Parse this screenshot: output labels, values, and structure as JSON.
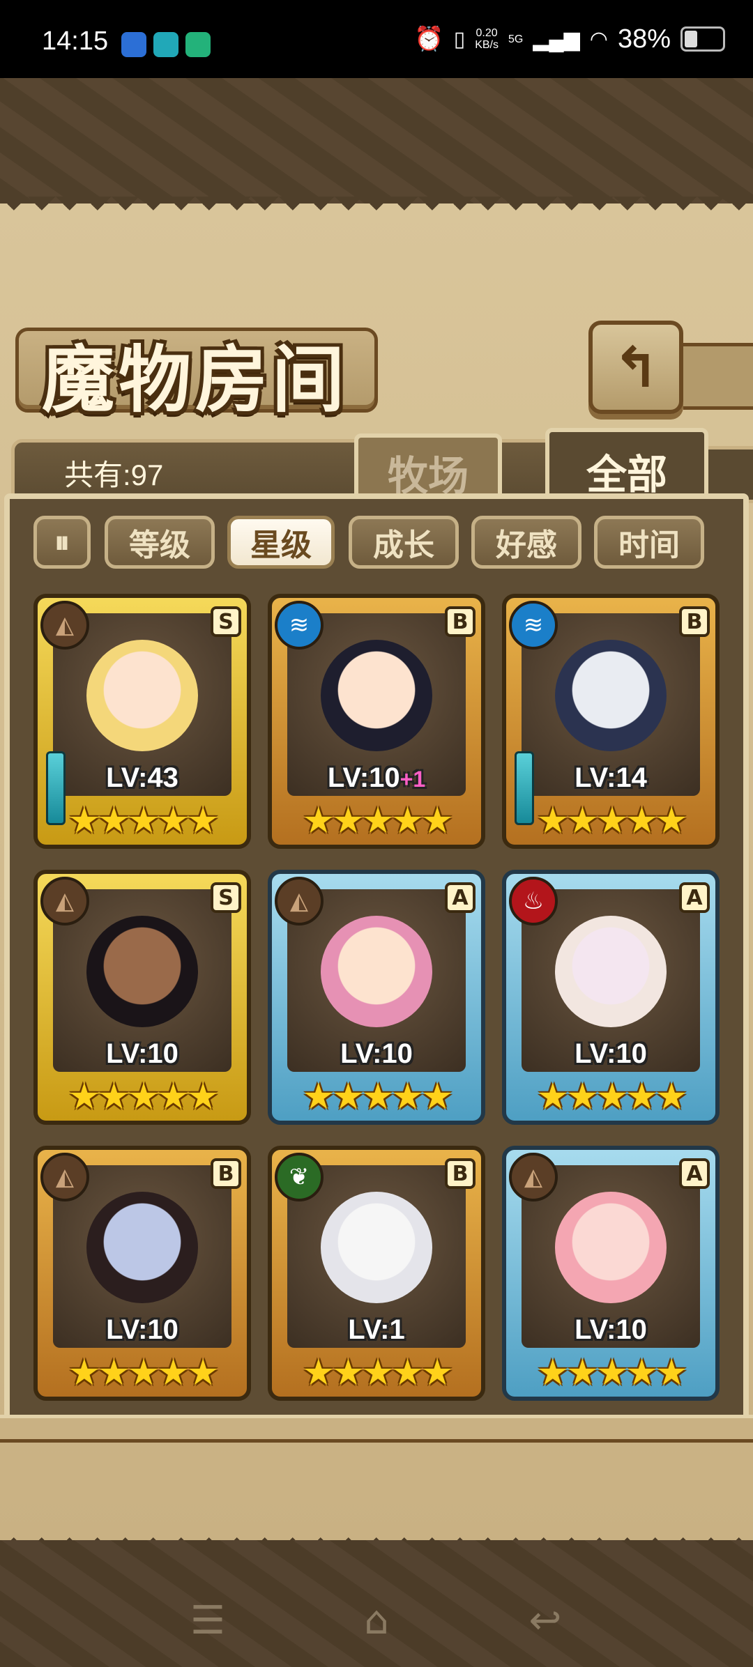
{
  "status_bar": {
    "time": "14:15",
    "net_speed_value": "0.20",
    "net_speed_unit": "KB/s",
    "network": "5G",
    "battery": "38%"
  },
  "header": {
    "title": "魔物房间",
    "back_icon": "back-arrow-icon"
  },
  "summary": {
    "count_label": "共有:97"
  },
  "tabs": [
    {
      "label": "牧场",
      "active": false
    },
    {
      "label": "全部",
      "active": true
    }
  ],
  "sort": {
    "toggle_icon": "sort-direction-icon",
    "options": [
      {
        "label": "等级",
        "active": false
      },
      {
        "label": "星级",
        "active": true
      },
      {
        "label": "成长",
        "active": false
      },
      {
        "label": "好感",
        "active": false
      },
      {
        "label": "时间",
        "active": false
      }
    ]
  },
  "monsters": [
    {
      "level": "LV:43",
      "plus": "",
      "rank": "S",
      "element": "earth",
      "frame": "gold",
      "stars": "★★★★★",
      "weapon": true
    },
    {
      "level": "LV:10",
      "plus": "+1",
      "rank": "B",
      "element": "water",
      "frame": "orange",
      "stars": "★★★★★",
      "weapon": false
    },
    {
      "level": "LV:14",
      "plus": "",
      "rank": "B",
      "element": "water",
      "frame": "orange",
      "stars": "★★★★★",
      "weapon": true
    },
    {
      "level": "LV:10",
      "plus": "",
      "rank": "S",
      "element": "earth",
      "frame": "gold",
      "stars": "★★★★★",
      "weapon": false
    },
    {
      "level": "LV:10",
      "plus": "",
      "rank": "A",
      "element": "earth",
      "frame": "blue",
      "stars": "★★★★★",
      "weapon": false
    },
    {
      "level": "LV:10",
      "plus": "",
      "rank": "A",
      "element": "fire",
      "frame": "blue",
      "stars": "★★★★★",
      "weapon": false
    },
    {
      "level": "LV:10",
      "plus": "",
      "rank": "B",
      "element": "earth",
      "frame": "orange",
      "stars": "★★★★★",
      "weapon": false
    },
    {
      "level": "LV:1",
      "plus": "",
      "rank": "B",
      "element": "wood",
      "frame": "orange",
      "stars": "★★★★★",
      "weapon": false
    },
    {
      "level": "LV:10",
      "plus": "",
      "rank": "A",
      "element": "earth",
      "frame": "blue",
      "stars": "★★★★★",
      "weapon": false
    }
  ],
  "nav": {
    "menu_icon": "menu-icon",
    "home_icon": "home-icon",
    "back_icon": "back-icon"
  }
}
